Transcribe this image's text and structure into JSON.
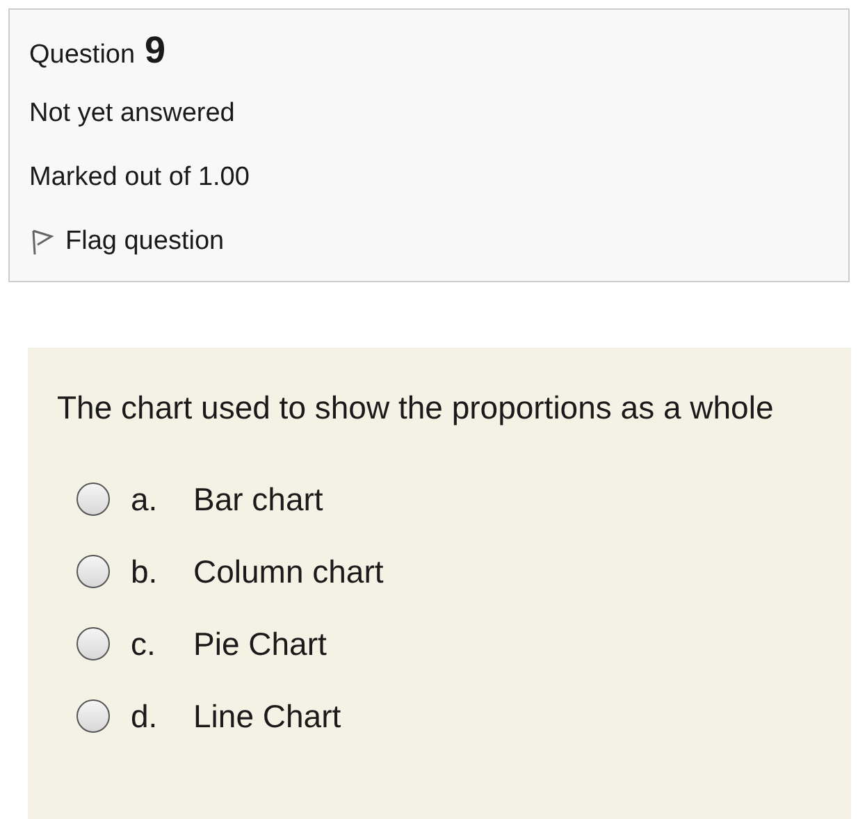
{
  "info": {
    "question_label": "Question",
    "question_number": "9",
    "status": "Not yet answered",
    "marks": "Marked out of 1.00",
    "flag": {
      "label": "Flag question",
      "flagged": false
    }
  },
  "question": {
    "text": "The chart used to show the proportions as a whole",
    "options": [
      {
        "letter": "a.",
        "label": "Bar chart",
        "selected": false
      },
      {
        "letter": "b.",
        "label": "Column chart",
        "selected": false
      },
      {
        "letter": "c.",
        "label": "Pie Chart",
        "selected": false
      },
      {
        "letter": "d.",
        "label": "Line Chart",
        "selected": false
      }
    ]
  }
}
